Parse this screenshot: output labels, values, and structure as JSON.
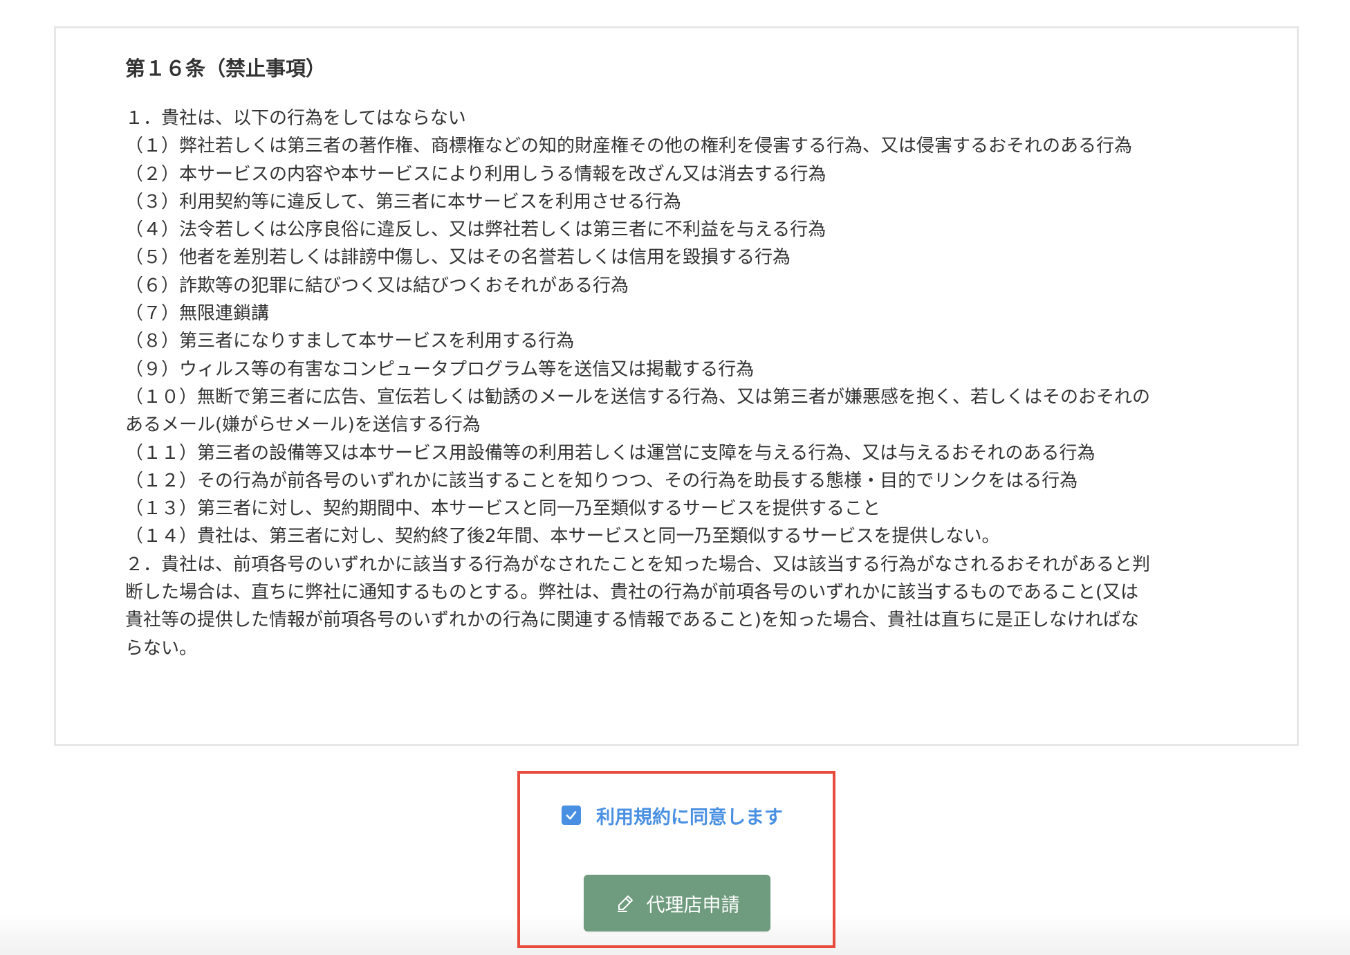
{
  "terms": {
    "title": "第１６条（禁止事項）",
    "lines": [
      "１．貴社は、以下の行為をしてはならない",
      "（１）弊社若しくは第三者の著作権、商標権などの知的財産権その他の権利を侵害する行為、又は侵害するおそれのある行為",
      "（２）本サービスの内容や本サービスにより利用しうる情報を改ざん又は消去する行為",
      "（３）利用契約等に違反して、第三者に本サービスを利用させる行為",
      "（４）法令若しくは公序良俗に違反し、又は弊社若しくは第三者に不利益を与える行為",
      "（５）他者を差別若しくは誹謗中傷し、又はその名誉若しくは信用を毀損する行為",
      "（６）詐欺等の犯罪に結びつく又は結びつくおそれがある行為",
      "（７）無限連鎖講",
      "（８）第三者になりすまして本サービスを利用する行為",
      "（９）ウィルス等の有害なコンピュータプログラム等を送信又は掲載する行為",
      "（１０）無断で第三者に広告、宣伝若しくは勧誘のメールを送信する行為、又は第三者が嫌悪感を抱く、若しくはそのおそれの",
      "あるメール(嫌がらせメール)を送信する行為",
      "（１１）第三者の設備等又は本サービス用設備等の利用若しくは運営に支障を与える行為、又は与えるおそれのある行為",
      "（１２）その行為が前各号のいずれかに該当することを知りつつ、その行為を助長する態様・目的でリンクをはる行為",
      "（１３）第三者に対し、契約期間中、本サービスと同一乃至類似するサービスを提供すること",
      "（１４）貴社は、第三者に対し、契約終了後2年間、本サービスと同一乃至類似するサービスを提供しない。",
      "２．貴社は、前項各号のいずれかに該当する行為がなされたことを知った場合、又は該当する行為がなされるおそれがあると判",
      "断した場合は、直ちに弊社に通知するものとする。弊社は、貴社の行為が前項各号のいずれかに該当するものであること(又は",
      "貴社等の提供した情報が前項各号のいずれかの行為に関連する情報であること)を知った場合、貴社は直ちに是正しなければな",
      "らない。"
    ]
  },
  "agreement": {
    "checked": true,
    "label": "利用規約に同意します"
  },
  "apply_button": {
    "label": "代理店申請",
    "icon": "pen-icon"
  },
  "colors": {
    "accent_blue": "#4a90e2",
    "button_green": "#6f9b7e",
    "highlight_red": "#e84a3c",
    "box_border": "#e7e7e7"
  }
}
